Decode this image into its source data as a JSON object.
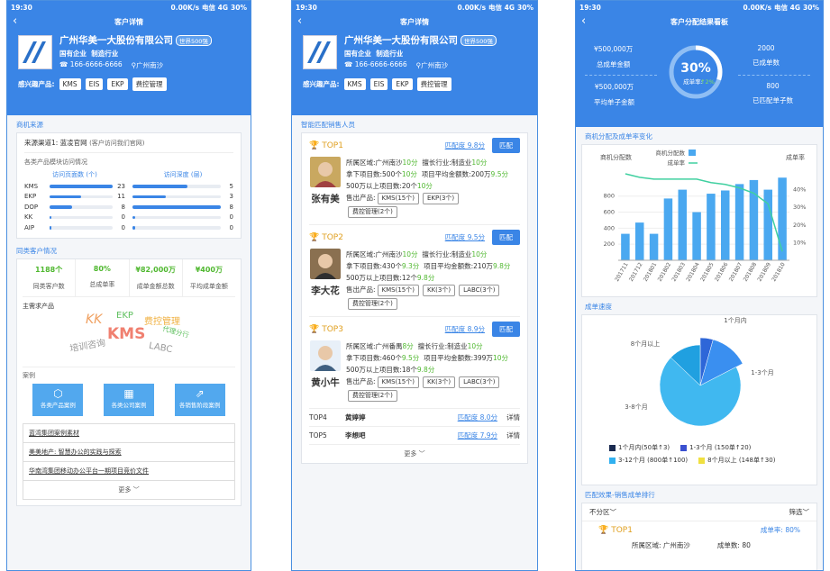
{
  "status": {
    "time": "19:30",
    "speed": "0.00K/s",
    "carrier": "电信 4G",
    "battery": "30%"
  },
  "p1": {
    "nav_title": "客户详情",
    "company": "广州华美一大股份有限公司",
    "badge": "世界500强",
    "type": "国有企业",
    "industry": "制造行业",
    "phone": "166-6666-6666",
    "location": "广州南沙",
    "interest_label": "感兴趣产品:",
    "interests": [
      "KMS",
      "EIS",
      "EKP",
      "费控管理"
    ],
    "sec1": "商机来源",
    "source": "来源渠道1: 蓝凌官网",
    "source_note": "(客户访问我们官网)",
    "visit_title": "各类产品模块访问情况",
    "col1": "访问页面数 (个)",
    "col2": "访问深度 (层)",
    "pages": [
      {
        "name": "KMS",
        "value": 23
      },
      {
        "name": "EKP",
        "value": 11
      },
      {
        "name": "DOP",
        "value": 8
      },
      {
        "name": "KK",
        "value": 0
      },
      {
        "name": "AIP",
        "value": 0
      }
    ],
    "depth": [
      5,
      3,
      8,
      0,
      0
    ],
    "sec2": "同类客户情况",
    "stats": [
      {
        "v": "1188个",
        "l": "同类客户数"
      },
      {
        "v": "80%",
        "l": "总成单率"
      },
      {
        "v": "¥82,000万",
        "l": "成单金额总数"
      },
      {
        "v": "¥400万",
        "l": "平均成单金额"
      }
    ],
    "need_title": "主需求产品",
    "words": {
      "w1": "KK",
      "w2": "EKP",
      "w3": "费控管理",
      "w4": "KMS",
      "w5": "培训咨询",
      "w6": "LABC",
      "w7": "代理分行"
    },
    "case_title": "案例",
    "cases": [
      "各类产品案例",
      "各类公司案例",
      "各销售阶段案例"
    ],
    "links": [
      "蓝湾集团案例素材",
      "美美地产: 智慧办公的实践与探索",
      "华南湾集团移动办公平台一期项目竞价文件"
    ],
    "more": "更多"
  },
  "p2": {
    "nav_title": "客户详情",
    "sec": "智能匹配销售人员",
    "match_btn": "匹配",
    "labels": {
      "region": "所属区域:",
      "ind": "擅长行业:",
      "won": "拿下项目数:",
      "avg": "项目平均金额数:",
      "big": "500万以上项目数:",
      "prod": "售出产品:"
    },
    "tops": [
      {
        "rank": "TOP1",
        "degree": "匹配度 9.8分",
        "name": "张有美",
        "region": "广州南沙",
        "region_s": "10分",
        "ind": "制造业",
        "ind_s": "10分",
        "won": "500个",
        "won_s": "10分",
        "avg": "200万",
        "avg_s": "9.5分",
        "big": "20个",
        "big_s": "10分",
        "prods": [
          "KMS(15个)",
          "EKP(3个)",
          "费控管理(2个)"
        ]
      },
      {
        "rank": "TOP2",
        "degree": "匹配度 9.5分",
        "name": "李大花",
        "region": "广州南沙",
        "region_s": "10分",
        "ind": "制造业",
        "ind_s": "10分",
        "won": "430个",
        "won_s": "9.3分",
        "avg": "210万",
        "avg_s": "9.8分",
        "big": "12个",
        "big_s": "9.8分",
        "prods": [
          "KMS(15个)",
          "KK(3个)",
          "LABC(3个)",
          "费控管理(2个)"
        ]
      },
      {
        "rank": "TOP3",
        "degree": "匹配度 8.9分",
        "name": "黄小牛",
        "region": "广州番禺",
        "region_s": "8分",
        "ind": "制造业",
        "ind_s": "10分",
        "won": "460个",
        "won_s": "9.5分",
        "avg": "399万",
        "avg_s": "10分",
        "big": "18个",
        "big_s": "9.8分",
        "prods": [
          "KMS(15个)",
          "KK(3个)",
          "LABC(3个)",
          "费控管理(2个)"
        ]
      }
    ],
    "rest": [
      {
        "rank": "TOP4",
        "name": "黄婷婷",
        "degree": "匹配度 8.0分",
        "detail": "详情"
      },
      {
        "rank": "TOP5",
        "name": "李想吧",
        "degree": "匹配度 7.9分",
        "detail": "详情"
      }
    ],
    "more": "更多"
  },
  "p3": {
    "nav_title": "客户分配结果看板",
    "kpis": {
      "v1": "¥500,000万",
      "l1": "总成单金额",
      "v2": "¥500,000万",
      "l2": "平均单子金额",
      "v3": "2000",
      "l3": "已成单数",
      "v4": "800",
      "l4": "已匹配单子数"
    },
    "rate": "30%",
    "rate_label": "成单率:",
    "rate_trend": "↑2%",
    "sec1": "商机分配及成单率变化",
    "ylabel_left": "商机分配数",
    "ylabel_right": "成单率",
    "legend_bar": "商机分配数",
    "legend_line": "成单率",
    "sec2": "成单速度",
    "sec3": "匹配效果-销售成单排行",
    "filter_left": "不分区",
    "filter_right": "筛选",
    "rank1": "TOP1",
    "rank1_rate": "成单率: 80%",
    "rank1_region": "所属区域: 广州南沙",
    "rank1_orders": "成单数: 80"
  },
  "chart_data": [
    {
      "type": "bar",
      "title": "",
      "categories": [
        "201711",
        "201712",
        "201801",
        "201802",
        "201803",
        "201804",
        "201805",
        "201806",
        "201807",
        "201808",
        "201809",
        "201810"
      ],
      "series": [
        {
          "name": "商机分配数",
          "values": [
            330,
            470,
            330,
            770,
            880,
            600,
            830,
            870,
            950,
            1000,
            880,
            1030
          ]
        },
        {
          "name": "成单率",
          "values": [
            49,
            47,
            46,
            46,
            46,
            46,
            44,
            43,
            41,
            38,
            32,
            5
          ]
        }
      ],
      "yticks_left": [
        200,
        400,
        600,
        800
      ],
      "yticks_right": [
        "10%",
        "20%",
        "30%",
        "40%"
      ],
      "ylim": [
        0,
        1100
      ],
      "ylim_right": [
        0,
        50
      ]
    },
    {
      "type": "pie",
      "title": "",
      "slices": [
        {
          "label": "1个月内",
          "value": 50,
          "color": "#2e66d8"
        },
        {
          "label": "1-3个月",
          "value": 150,
          "color": "#3a8ff0"
        },
        {
          "label": "3-8个月",
          "value": 800,
          "color": "#40b8f0"
        },
        {
          "label": "8个月以上",
          "value": 148,
          "color": "#20a0e0"
        }
      ],
      "legend": [
        "1个月内(50单↑3)",
        "1-3个月 (150单↑20)",
        "3-12个月 (800单↑100)",
        "8个月以上 (148单↑30)"
      ]
    }
  ]
}
